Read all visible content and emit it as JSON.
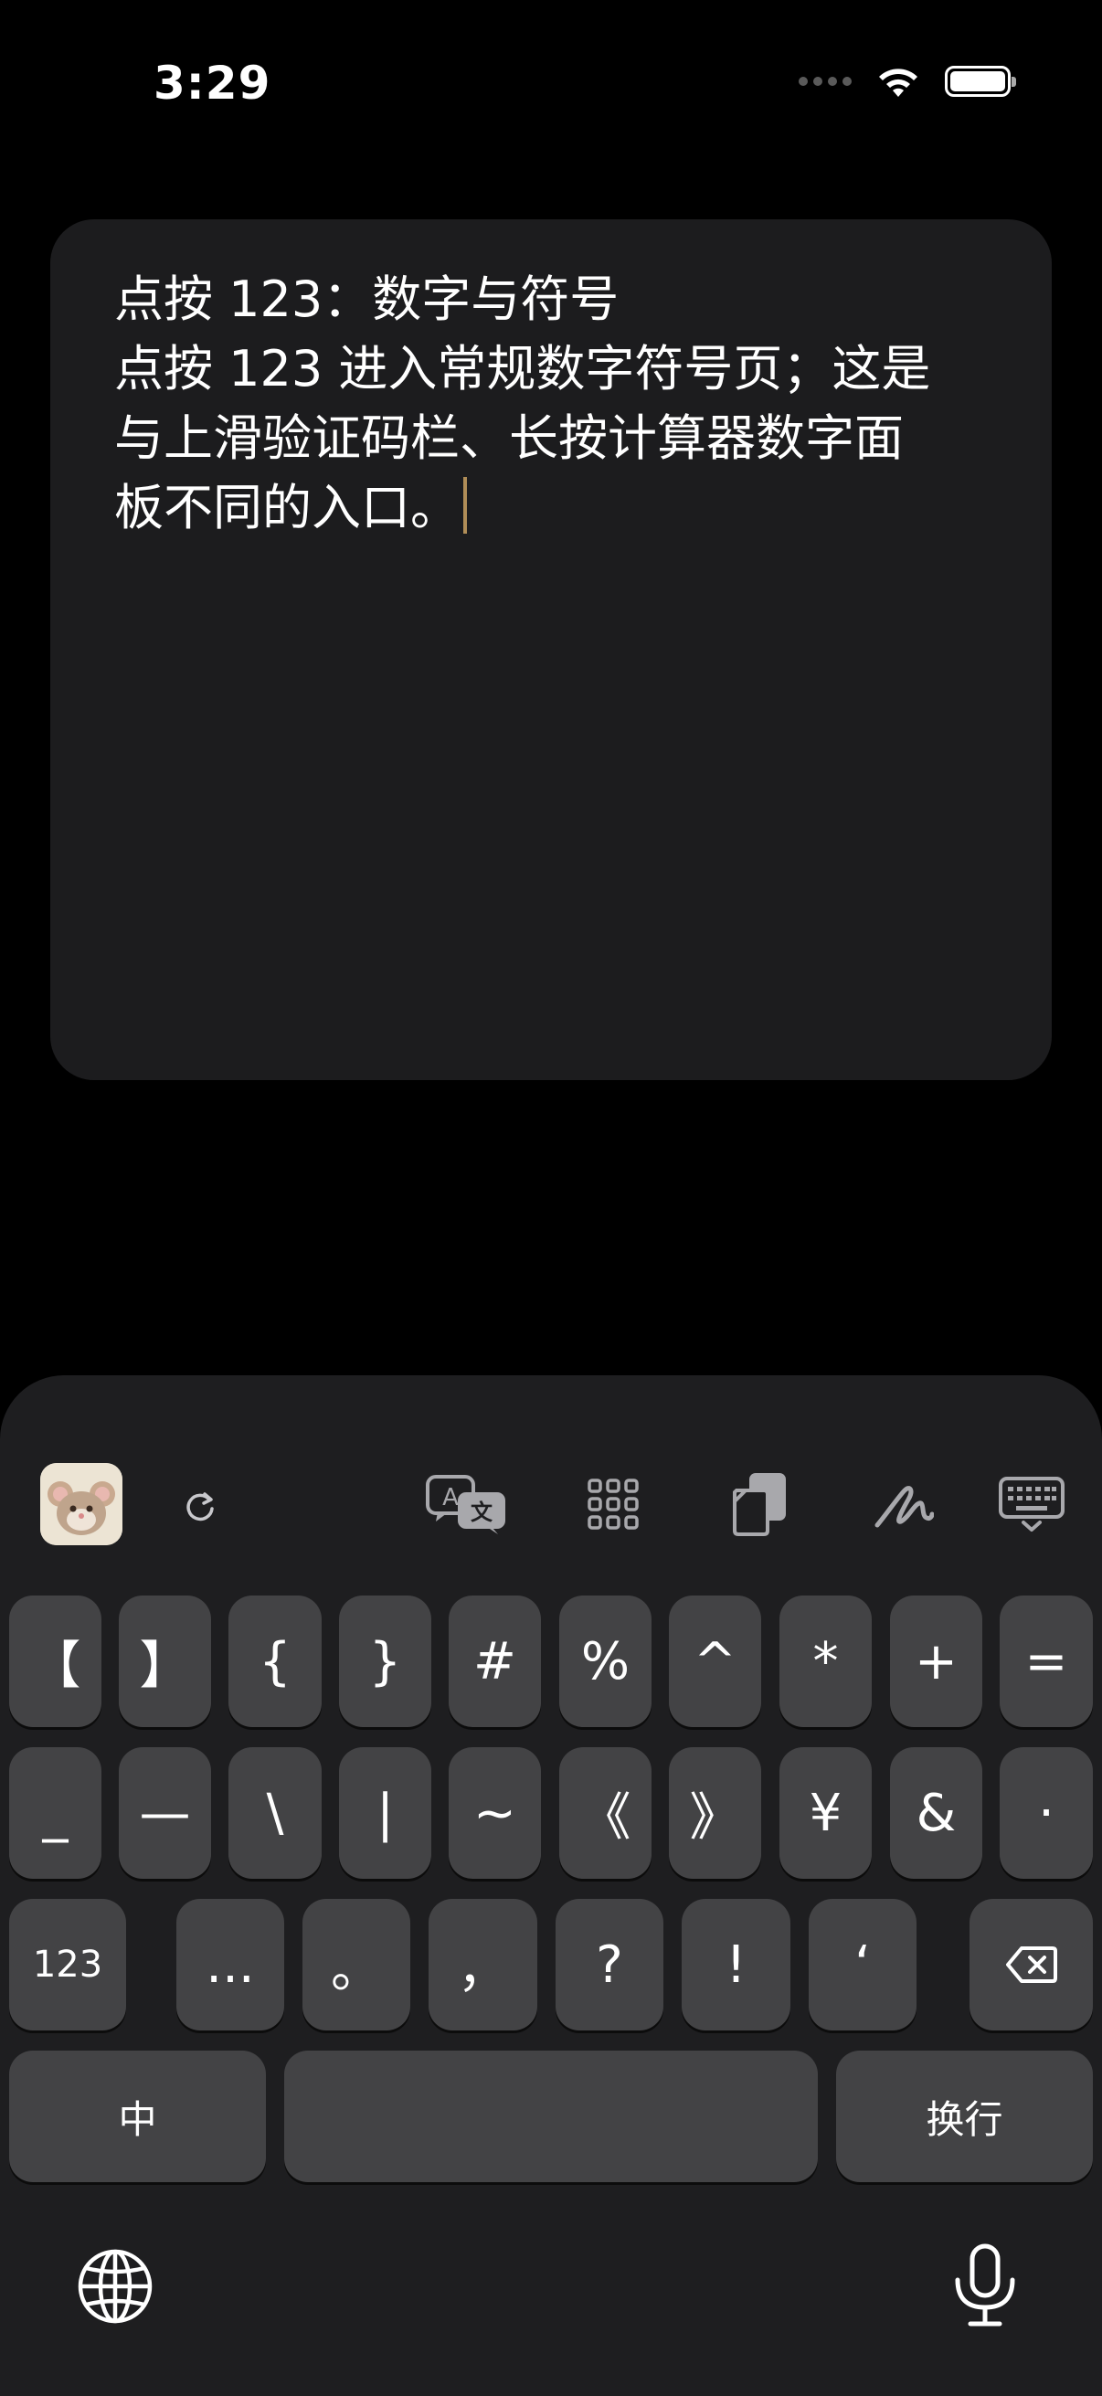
{
  "status": {
    "time": "3:29"
  },
  "editor": {
    "lines": [
      "点按 123：数字与符号",
      "点按 123 进入常规数字符号页；这是",
      "与上滑验证码栏、长按计算器数字面",
      "板不同的入口。"
    ]
  },
  "toolbar": {
    "icons": [
      "app-avatar-icon",
      "refresh-icon",
      "translate-icon",
      "grid-icon",
      "clipboard-icon",
      "handwriting-icon",
      "keyboard-hide-icon"
    ]
  },
  "keyboard": {
    "row1": [
      "【",
      "】",
      "{",
      "}",
      "#",
      "%",
      "^",
      "*",
      "+",
      "="
    ],
    "row2": [
      "_",
      "—",
      "\\",
      "|",
      "~",
      "《",
      "》",
      "¥",
      "&",
      "·"
    ],
    "row3": {
      "mode": "123",
      "keys": [
        "...",
        "。",
        "，",
        "?",
        "!",
        "‘"
      ]
    },
    "row4": {
      "left": "中",
      "space": "",
      "enter": "换行"
    }
  },
  "bottom": {
    "icons": [
      "globe-icon",
      "microphone-icon"
    ]
  }
}
